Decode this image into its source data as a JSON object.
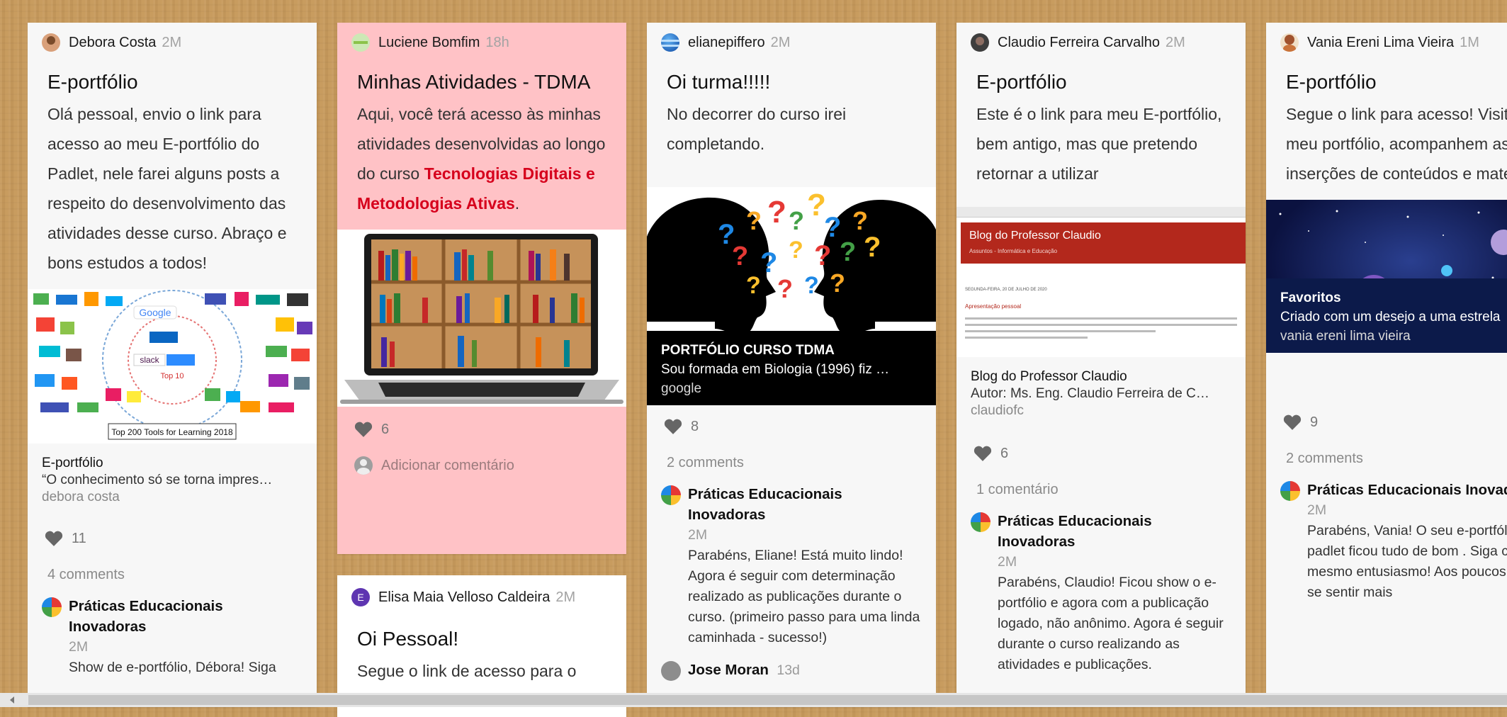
{
  "cards": {
    "c1": {
      "author": "Debora Costa",
      "time": "2M",
      "title": "E-portfólio",
      "body": "Olá pessoal, envio o link para acesso ao meu E-portfólio do Padlet, nele farei alguns posts a respeito do desenvolvimento das atividades desse curso. Abraço e bons estudos a todos!",
      "attach_title": "E-portfólio",
      "attach_desc": "“O conhecimento só se torna impres…",
      "attach_source": "debora costa",
      "attach_image_text": "Top 200 Tools for Learning 2018",
      "likes": "11",
      "comments_count": "4 comments",
      "comment": {
        "author": "Práticas Educacionais Inovadoras",
        "time": "2M",
        "text": "Show de e-portfólio, Débora! Siga"
      }
    },
    "c2": {
      "author": "Luciene Bomfim",
      "time": "18h",
      "title": "Minhas Atividades - TDMA",
      "body_pre": "Aqui, você terá acesso às minhas atividades desenvolvidas ao longo do curso ",
      "body_highlight": "Tecnologias Digitais e Metodologias Ativas",
      "body_post": ".",
      "likes": "6",
      "add_comment": "Adicionar comentário"
    },
    "c2b": {
      "author": "Elisa Maia Velloso Caldeira",
      "time": "2M",
      "avatar_letter": "E",
      "title": "Oi Pessoal!",
      "body": "Segue o link de acesso para o"
    },
    "c3": {
      "author": "elianepiffero",
      "time": "2M",
      "title": "Oi turma!!!!!",
      "body": "No decorrer do curso irei completando.",
      "attach_title": "PORTFÓLIO CURSO TDMA",
      "attach_desc": "Sou formada em Biologia (1996) fiz …",
      "attach_source": "google",
      "likes": "8",
      "comments_count": "2 comments",
      "comment": {
        "author": "Práticas Educacionais Inovadoras",
        "time": "2M",
        "text": "Parabéns, Eliane! Está muito lindo! Agora é seguir com determinação realizado as publicações durante o curso. (primeiro passo para uma linda caminhada - sucesso!)"
      },
      "comment2": {
        "author": "Jose Moran",
        "time": "13d"
      }
    },
    "c4": {
      "author": "Claudio Ferreira Carvalho",
      "time": "2M",
      "title": "E-portfólio",
      "body": "Este é o link para meu E-portfólio, bem antigo, mas que pretendo retornar a utilizar",
      "attach_title": "Blog do Professor Claudio",
      "attach_desc": "Autor: Ms. Eng. Claudio Ferreira de C…",
      "attach_source": "claudiofc",
      "thumb_blog_title": "Blog do Professor Claudio",
      "thumb_blog_sub": "Assuntos - Informática e Educação",
      "thumb_blog_date": "SEGUNDA-FEIRA, 20 DE JULHO DE 2020",
      "thumb_blog_post": "Apresentação pessoal",
      "likes": "6",
      "comments_count": "1 comentário",
      "comment": {
        "author": "Práticas Educacionais Inovadoras",
        "time": "2M",
        "text": "Parabéns, Claudio! Ficou show o e-portfólio e agora com a publicação logado, não anônimo. Agora é seguir durante o curso realizando as atividades e publicações."
      }
    },
    "c5": {
      "author": "Vania Ereni Lima Vieira",
      "time": "1M",
      "title": "E-portfólio",
      "body": "Segue o link para acesso! Visitem meu portfólio, acompanhem as inserções de conteúdos e materiais!",
      "attach_title": "Favoritos",
      "attach_desc": "Criado com um desejo a uma estrela",
      "attach_source": "vania ereni lima vieira",
      "likes": "9",
      "comments_count": "2 comments",
      "comment": {
        "author": "Práticas Educacionais Inovadoras",
        "time": "2M",
        "text": "Parabéns, Vania! O seu e-portfólio no padlet ficou tudo de bom . Siga com o mesmo entusiasmo! Aos poucos você irá se sentir mais"
      }
    }
  },
  "colors": {
    "highlight": "#d6001c",
    "pink_card": "#ffc2c6",
    "board_bg": "#c79a5c"
  },
  "icons": [
    "heart-icon",
    "scroll-left-arrow-icon"
  ]
}
